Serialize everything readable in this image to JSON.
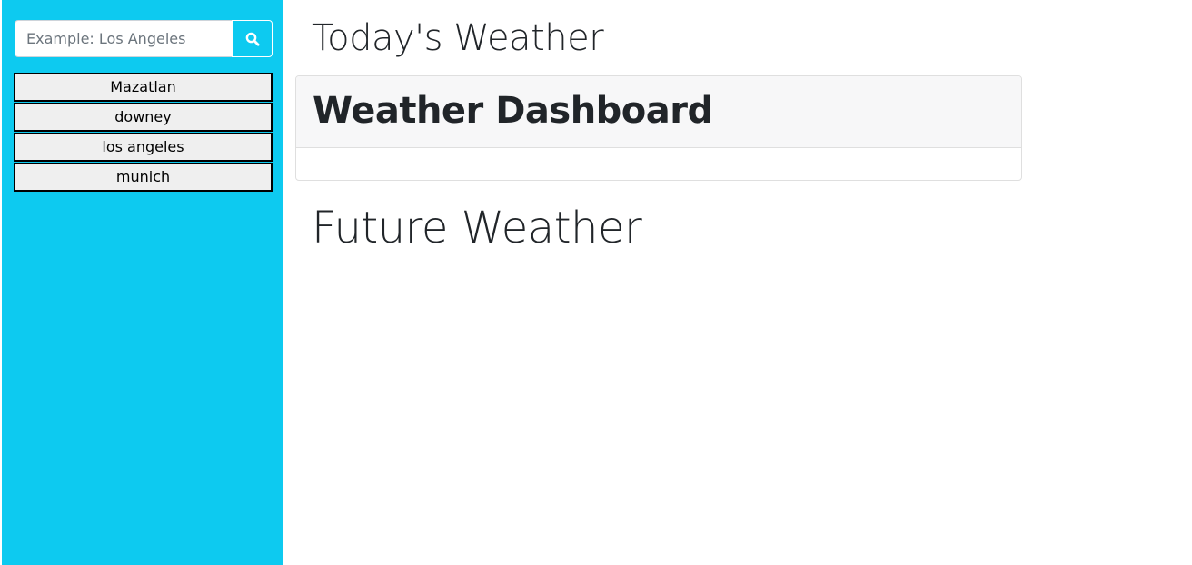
{
  "sidebar": {
    "search": {
      "placeholder": "Example: Los Angeles",
      "value": "",
      "button_icon": "search-icon"
    },
    "history": [
      {
        "label": "Mazatlan"
      },
      {
        "label": "downey"
      },
      {
        "label": "los angeles"
      },
      {
        "label": "munich"
      }
    ],
    "background_color": "#0dcaf0"
  },
  "main": {
    "today_title": "Today's Weather",
    "card": {
      "title": "Weather Dashboard",
      "body": ""
    },
    "future_title": "Future Weather"
  }
}
